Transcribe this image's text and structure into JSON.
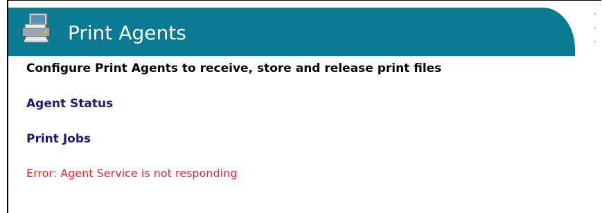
{
  "header": {
    "title": "Print Agents",
    "icon": "printer-computer-icon",
    "band_color": "#0a7b93"
  },
  "description": "Configure Print Agents to receive, store and release print files",
  "links": {
    "agent_status": "Agent Status",
    "print_jobs": "Print Jobs"
  },
  "error": {
    "message": "Error: Agent Service is not responding",
    "color": "#e8242e"
  },
  "colors": {
    "link": "#1a1a6e",
    "text": "#000000"
  }
}
